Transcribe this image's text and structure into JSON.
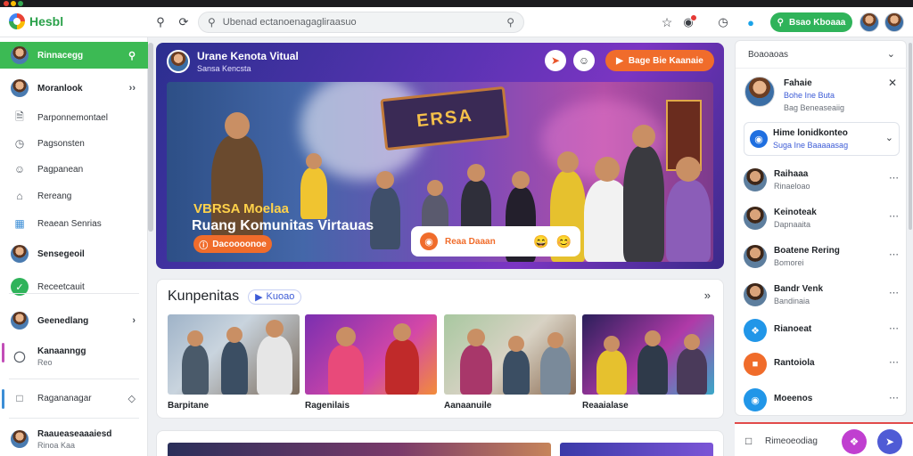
{
  "colors": {
    "brand_green": "#2fb35a",
    "accent_orange": "#f06c2b",
    "accent_blue": "#3c5bd6",
    "hero_purple": "#5a33b3"
  },
  "app": {
    "name": "Hesbl"
  },
  "header": {
    "search_value": "Ubenad ectanoenagagliraasuo",
    "join_label": "Bsao Kboaaa"
  },
  "sidebar": {
    "items": [
      {
        "label": "Rinnacegg",
        "icon": "globe-icon"
      },
      {
        "label": "Moranlook",
        "icon": "avatar"
      },
      {
        "label": "Parponnemontael",
        "icon": "document-icon"
      },
      {
        "label": "Pagsonsten",
        "icon": "clock-icon"
      },
      {
        "label": "Pagpanean",
        "icon": "account-icon"
      },
      {
        "label": "Rereang",
        "icon": "home-icon"
      },
      {
        "label": "Reaean Senrias",
        "icon": "grid-icon"
      },
      {
        "label": "Sensegeoil",
        "icon": "avatar"
      },
      {
        "label": "Receetcauit",
        "icon": "check-icon"
      },
      {
        "label": "Geenedlang",
        "icon": "avatar"
      },
      {
        "label": "Kanaanngg",
        "sub": "Reo",
        "icon": "circle-icon"
      },
      {
        "label": "Ragananagar",
        "icon": "chat-icon"
      },
      {
        "label": "Raaueaseaaaiesd",
        "sub": "Rinoa Kaa",
        "icon": "avatar"
      }
    ]
  },
  "hero": {
    "title": "Urane Kenota Vitual",
    "subtitle": "Sansa Kencsta",
    "cta_label": "Bage Bie Kaanaie",
    "sign_text": "ERSA",
    "scene_title1": "VBRSA Moelaa",
    "scene_title2": "Ruang Komunitas Virtauas",
    "scene_btn": "Dacoooonoe",
    "pill_text": "Reaa Daaan"
  },
  "communities": {
    "title": "Kunpenitas",
    "badge": "Kuoao",
    "cards": [
      {
        "label": "Barpitane"
      },
      {
        "label": "Ragenilais"
      },
      {
        "label": "Aanaanuile"
      },
      {
        "label": "Reaaialase"
      }
    ]
  },
  "right_panel": {
    "header": "Boaoaoas",
    "profile": {
      "name": "Fahaie",
      "meta": "Bohe Ine Buta",
      "meta2": "Bag Beneaseaiig"
    },
    "group": {
      "title": "Hime lonidkonteo",
      "sub": "Suga Ine Baaaaasag"
    },
    "friends": [
      {
        "name": "Raihaaa",
        "status": "Rinaeloao",
        "kind": "photo"
      },
      {
        "name": "Keinoteak",
        "status": "Dapnaaita",
        "kind": "photo"
      },
      {
        "name": "Boatene Rering",
        "status": "Bomorei",
        "kind": "photo"
      },
      {
        "name": "Bandr Venk",
        "status": "Bandinaia",
        "kind": "photo"
      },
      {
        "name": "Rianoeat",
        "status": "",
        "kind": "blue"
      },
      {
        "name": "Rantoiola",
        "status": "",
        "kind": "orange"
      },
      {
        "name": "Moeenos",
        "status": "",
        "kind": "blue"
      }
    ],
    "compose_placeholder": "Rimeoeodiag"
  }
}
